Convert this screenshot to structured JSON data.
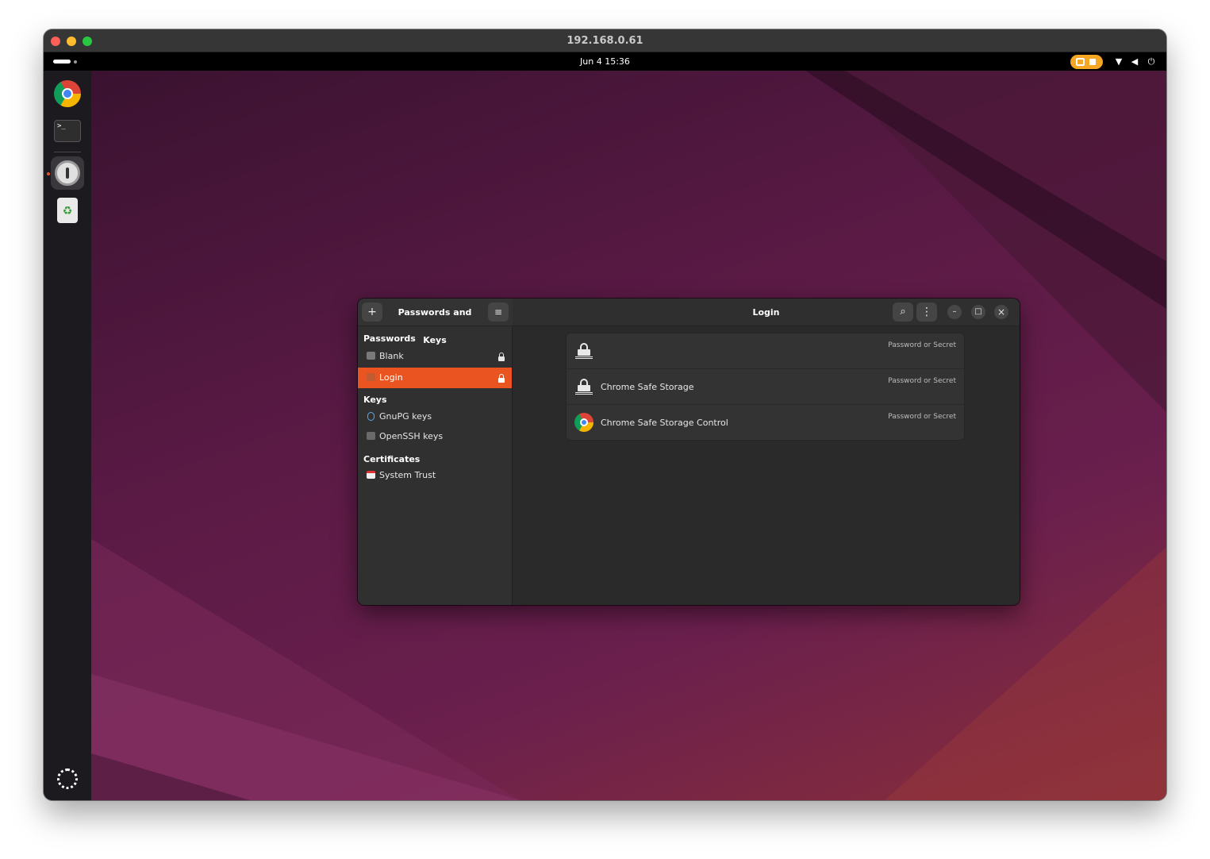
{
  "mac_window": {
    "title": "192.168.0.61"
  },
  "topbar": {
    "clock": "Jun 4  15:36"
  },
  "dock": {
    "items": [
      {
        "name": "chrome-icon"
      },
      {
        "name": "terminal-icon",
        "glyph": ">_"
      },
      {
        "name": "password-manager-icon"
      },
      {
        "name": "trash-icon",
        "glyph": "♻"
      }
    ]
  },
  "app": {
    "sidebar_title": "Passwords and Keys",
    "main_title": "Login",
    "add_glyph": "+",
    "menu_glyph": "≡",
    "search_glyph": "⌕",
    "more_glyph": "⋮",
    "minimize_glyph": "–",
    "maximize_glyph": "□",
    "close_glyph": "×",
    "sections": {
      "passwords": "Passwords",
      "keys": "Keys",
      "certificates": "Certificates"
    },
    "password_items": [
      {
        "label": "Blank",
        "locked": true
      },
      {
        "label": "Login",
        "locked": true,
        "selected": true
      }
    ],
    "key_items": [
      {
        "label": "GnuPG keys"
      },
      {
        "label": "OpenSSH keys"
      }
    ],
    "certificate_items": [
      {
        "label": "System Trust"
      }
    ],
    "entries": [
      {
        "name": "",
        "type": "Password or Secret",
        "icon": "padlock-icon"
      },
      {
        "name": "Chrome Safe Storage",
        "type": "Password or Secret",
        "icon": "padlock-icon"
      },
      {
        "name": "Chrome Safe Storage Control",
        "type": "Password or Secret",
        "icon": "chrome-icon"
      }
    ]
  },
  "colors": {
    "accent": "#e95420",
    "sidebar_bg": "#303030",
    "content_bg": "#2a2a2a"
  }
}
